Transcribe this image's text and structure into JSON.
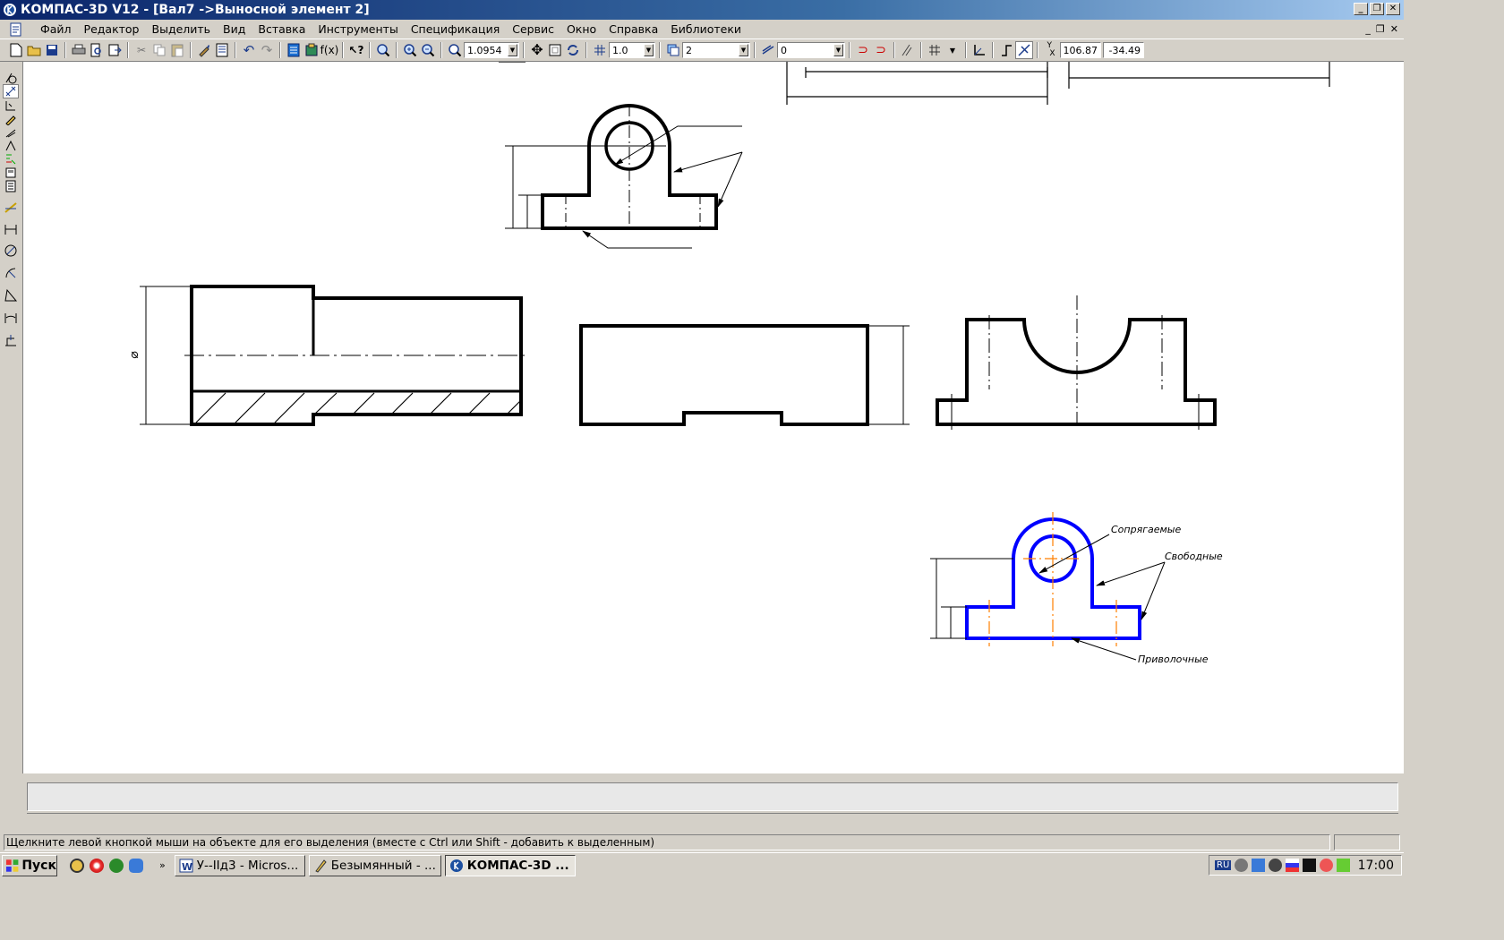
{
  "window": {
    "title": "КОМПАС-3D V12 - [Вал7 ->Выносной элемент 2]"
  },
  "menu": [
    "Файл",
    "Редактор",
    "Выделить",
    "Вид",
    "Вставка",
    "Инструменты",
    "Спецификация",
    "Сервис",
    "Окно",
    "Справка",
    "Библиотеки"
  ],
  "toolbar": {
    "zoom_value": "1.0954",
    "step_value": "1.0",
    "layer_value": "2",
    "style_value": "0",
    "coord_x": "106.87",
    "coord_y": "-34.49"
  },
  "drawing": {
    "annotations": {
      "mating": "Сопрягаемые",
      "free": "Свободные",
      "fitting": "Приволочные"
    },
    "diameter_symbol": "⌀",
    "colors": {
      "contour": "#000000",
      "highlight": "#0000ff",
      "axis_highlight": "#ff7f00"
    }
  },
  "status": {
    "hint": "Щелкните левой кнопкой мыши на объекте для его выделения (вместе с Ctrl или Shift - добавить к выделенным)"
  },
  "taskbar": {
    "start": "Пуск",
    "tasks": [
      "У--IIд3 - Micros...",
      "Безымянный - ...",
      "КОМПАС-3D ..."
    ],
    "tray_lang": "RU",
    "clock": "17:00"
  }
}
